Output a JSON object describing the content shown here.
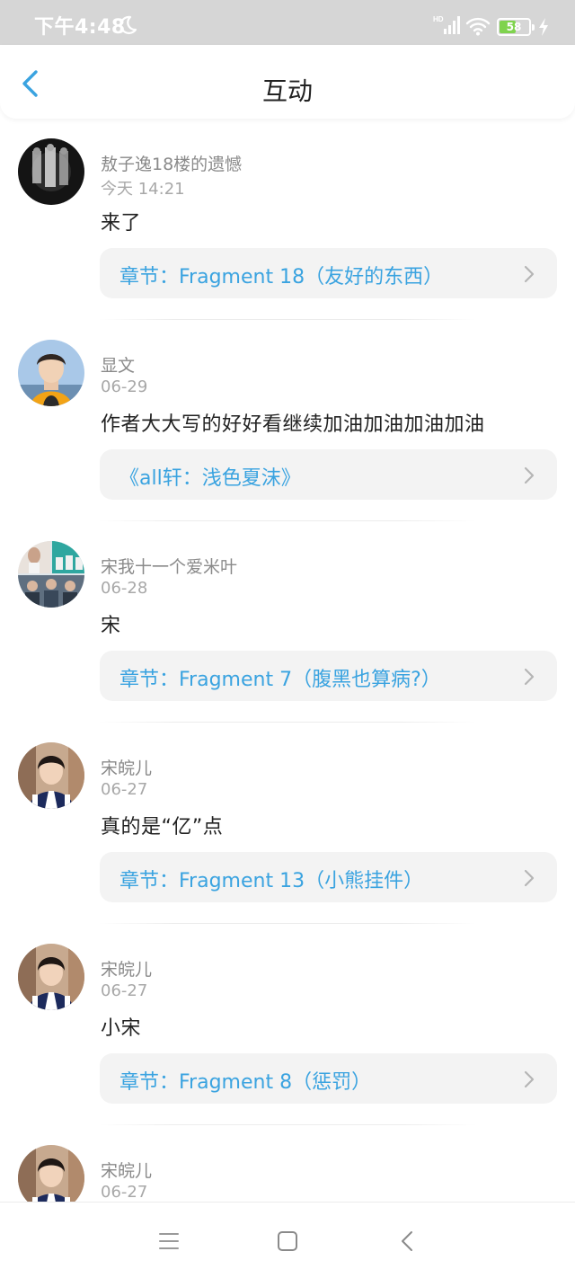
{
  "status_bar": {
    "time": "下午4:48",
    "battery_level": "58",
    "battery_percent": 58,
    "network": "HD"
  },
  "header": {
    "title": "互动",
    "back_icon": "chevron-left-icon"
  },
  "colors": {
    "accent": "#3aa3e0",
    "status_bar": "#d6d6d6",
    "battery_green": "#7fd34e",
    "card_bg": "#f3f3f3"
  },
  "comments": [
    {
      "user": "敖子逸18楼的遗憾",
      "date": "今天 14:21",
      "text": "来了",
      "link": "章节：Fragment 18（友好的东西）"
    },
    {
      "user": "显文",
      "date": "06-29",
      "text": "作者大大写的好好看继续加油加油加油加油",
      "link": "《all轩：浅色夏沫》"
    },
    {
      "user": "宋我十一个爱米叶",
      "date": "06-28",
      "text": "宋",
      "link": "章节：Fragment 7（腹黑也算病?）"
    },
    {
      "user": "宋皖儿",
      "date": "06-27",
      "text": "真的是“亿”点",
      "link": "章节：Fragment 13（小熊挂件）"
    },
    {
      "user": "宋皖儿",
      "date": "06-27",
      "text": "小宋",
      "link": "章节：Fragment 8（惩罚）"
    },
    {
      "user": "宋皖儿",
      "date": "06-27",
      "text": "",
      "link": ""
    }
  ],
  "nav_bar": {
    "items": [
      "menu-icon",
      "home-square-icon",
      "back-triangle-icon"
    ]
  }
}
